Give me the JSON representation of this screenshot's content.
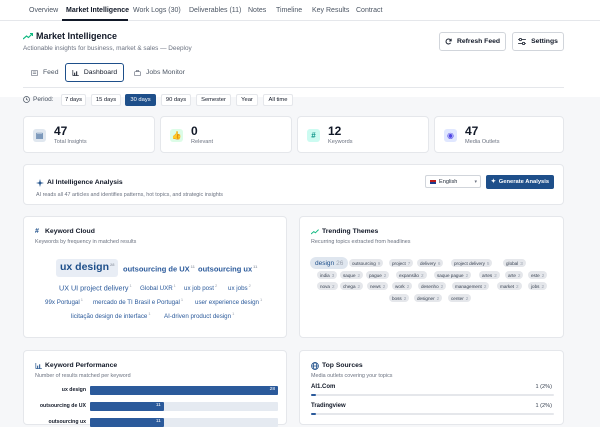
{
  "tabs": [
    "Overview",
    "Market Intelligence",
    "Work Logs (30)",
    "Deliverables (11)",
    "Notes",
    "Timeline",
    "Key Results",
    "Contract"
  ],
  "header": {
    "title": "Market Intelligence",
    "subtitle": "Actionable insights for business, market & sales — Deeploy",
    "refresh_label": "Refresh Feed",
    "settings_label": "Settings"
  },
  "views": [
    "Feed",
    "Dashboard",
    "Jobs Monitor"
  ],
  "period": {
    "label": "Period:",
    "options": [
      "7 days",
      "15 days",
      "30 days",
      "90 days",
      "Semester",
      "Year",
      "All time"
    ],
    "selected": "30 days"
  },
  "stats": [
    {
      "value": "47",
      "label": "Total Insights",
      "icon": "newspaper-icon"
    },
    {
      "value": "0",
      "label": "Relevant",
      "icon": "thumbs-up-icon"
    },
    {
      "value": "12",
      "label": "Keywords",
      "icon": "hash-icon"
    },
    {
      "value": "47",
      "label": "Media Outlets",
      "icon": "globe-icon"
    }
  ],
  "ai": {
    "title": "AI Intelligence Analysis",
    "subtitle": "AI reads all 47 articles and identifies patterns, hot topics, and strategic insights",
    "language": "English",
    "button_label": "Generate Analysis"
  },
  "keyword_cloud": {
    "title": "Keyword Cloud",
    "subtitle": "Keywords by frequency in matched results",
    "words": [
      {
        "text": "ux design",
        "count": "28"
      },
      {
        "text": "outsourcing de UX",
        "count": "11"
      },
      {
        "text": "outsourcing ux",
        "count": "11"
      },
      {
        "text": "UX UI project delivery",
        "count": "1"
      },
      {
        "text": "Global UXR",
        "count": "1"
      },
      {
        "text": "ux job post",
        "count": "2"
      },
      {
        "text": "ux jobs",
        "count": "2"
      },
      {
        "text": "99x Portugal",
        "count": "1"
      },
      {
        "text": "mercado de TI Brasil e Portugal",
        "count": "1"
      },
      {
        "text": "user experience design",
        "count": "1"
      },
      {
        "text": "licitação design de interface",
        "count": "1"
      },
      {
        "text": "AI-driven product design",
        "count": "1"
      }
    ]
  },
  "trending": {
    "title": "Trending Themes",
    "subtitle": "Recurring topics extracted from headlines",
    "themes": [
      {
        "text": "design",
        "count": "26"
      },
      {
        "text": "outsourcing",
        "count": "9"
      },
      {
        "text": "project",
        "count": "7"
      },
      {
        "text": "delivery",
        "count": "6"
      },
      {
        "text": "project delivery",
        "count": "5"
      },
      {
        "text": "global",
        "count": "3"
      },
      {
        "text": "india",
        "count": "3"
      },
      {
        "text": "saque",
        "count": "2"
      },
      {
        "text": "pague",
        "count": "2"
      },
      {
        "text": "expansão",
        "count": "2"
      },
      {
        "text": "saque pague",
        "count": "2"
      },
      {
        "text": "artes",
        "count": "2"
      },
      {
        "text": "arte",
        "count": "2"
      },
      {
        "text": "este",
        "count": "2"
      },
      {
        "text": "nova",
        "count": "2"
      },
      {
        "text": "chega",
        "count": "2"
      },
      {
        "text": "news",
        "count": "2"
      },
      {
        "text": "work",
        "count": "2"
      },
      {
        "text": "desenho",
        "count": "2"
      },
      {
        "text": "management",
        "count": "2"
      },
      {
        "text": "market",
        "count": "2"
      },
      {
        "text": "jobs",
        "count": "2"
      },
      {
        "text": "boss",
        "count": "2"
      },
      {
        "text": "designer",
        "count": "2"
      },
      {
        "text": "center",
        "count": "2"
      }
    ]
  },
  "kw_perf": {
    "title": "Keyword Performance",
    "subtitle": "Number of results matched per keyword",
    "max": 28,
    "rows": [
      {
        "label": "ux design",
        "value": 28
      },
      {
        "label": "outsourcing de UX",
        "value": 11
      },
      {
        "label": "outsourcing ux",
        "value": 11
      }
    ]
  },
  "top_sources": {
    "title": "Top Sources",
    "subtitle": "Media outlets covering your topics",
    "rows": [
      {
        "name": "AI1.Com",
        "pct": "1 (2%)",
        "fraction": 0.02
      },
      {
        "name": "Tradingview",
        "pct": "1 (2%)",
        "fraction": 0.02
      }
    ]
  },
  "colors": {
    "accent": "#1e4f8a",
    "bar": "#2b5a9b",
    "trend_icon": "#10b981"
  }
}
